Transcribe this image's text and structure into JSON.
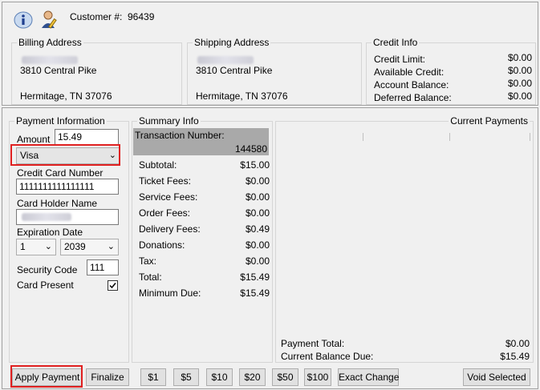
{
  "header": {
    "customer_label": "Customer #:",
    "customer_number": "96439"
  },
  "billing": {
    "title": "Billing Address",
    "street": "3810 Central Pike",
    "city": "Hermitage, TN 37076"
  },
  "shipping": {
    "title": "Shipping Address",
    "street": "3810 Central Pike",
    "city": "Hermitage, TN 37076"
  },
  "credit": {
    "title": "Credit Info",
    "rows": [
      {
        "label": "Credit Limit:",
        "value": "$0.00"
      },
      {
        "label": "Available Credit:",
        "value": "$0.00"
      },
      {
        "label": "Account Balance:",
        "value": "$0.00"
      },
      {
        "label": "Deferred Balance:",
        "value": "$0.00"
      }
    ]
  },
  "payment": {
    "title": "Payment Information",
    "amount_label": "Amount",
    "amount_value": "15.49",
    "card_type": "Visa",
    "cc_label": "Credit Card Number",
    "cc_value": "1111111111111111",
    "holder_label": "Card Holder Name",
    "exp_label": "Expiration Date",
    "exp_month": "1",
    "exp_year": "2039",
    "cvv_label": "Security Code",
    "cvv_value": "111",
    "present_label": "Card Present",
    "present_checked": true
  },
  "summary": {
    "title": "Summary Info",
    "txn_label": "Transaction Number:",
    "txn_number": "144580",
    "rows": [
      {
        "label": "Subtotal:",
        "value": "$15.00"
      },
      {
        "label": "Ticket Fees:",
        "value": "$0.00"
      },
      {
        "label": "Service Fees:",
        "value": "$0.00"
      },
      {
        "label": "Order Fees:",
        "value": "$0.00"
      },
      {
        "label": "Delivery Fees:",
        "value": "$0.49"
      },
      {
        "label": "Donations:",
        "value": "$0.00"
      },
      {
        "label": "Tax:",
        "value": "$0.00"
      },
      {
        "label": "Total:",
        "value": "$15.49"
      },
      {
        "label": "Minimum Due:",
        "value": "$15.49"
      }
    ]
  },
  "current": {
    "title": "Current Payments",
    "payment_total_label": "Payment Total:",
    "payment_total": "$0.00",
    "balance_label": "Current Balance Due:",
    "balance": "$15.49"
  },
  "buttons": {
    "apply": "Apply Payment",
    "finalize": "Finalize",
    "q1": "$1",
    "q5": "$5",
    "q10": "$10",
    "q20": "$20",
    "q50": "$50",
    "q100": "$100",
    "exact": "Exact Change",
    "void": "Void Selected"
  },
  "icons": {
    "info": "info-icon",
    "user": "user-edit-icon"
  },
  "colors": {
    "highlight_border": "#e02020",
    "txn_bg": "#a9a9a9"
  }
}
